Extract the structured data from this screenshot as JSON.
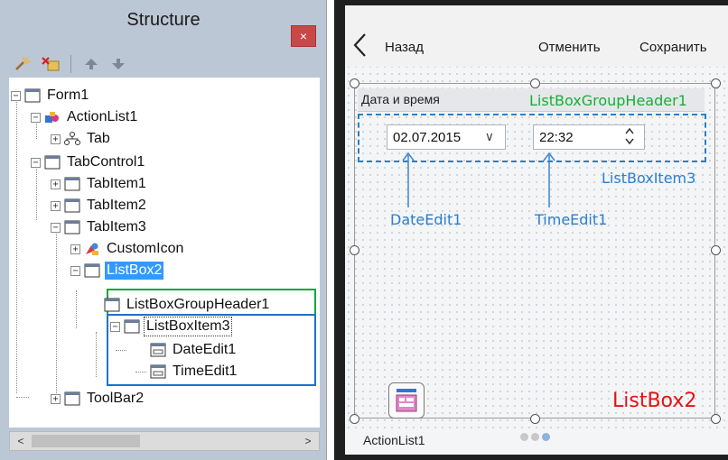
{
  "structure_panel": {
    "title": "Structure",
    "close_label": "×",
    "toolbar": {
      "icons": [
        "new-item-icon",
        "delete-item-icon",
        "move-up-icon",
        "move-down-icon"
      ]
    },
    "tree": [
      {
        "label": "Form1",
        "expander": "−",
        "icon": "form-icon"
      },
      {
        "label": "ActionList1",
        "expander": "−",
        "icon": "actionlist-icon"
      },
      {
        "label": "Tab",
        "expander": "+",
        "icon": "tab-hierarchy-icon"
      },
      {
        "label": "TabControl1",
        "expander": "−",
        "icon": "window-icon"
      },
      {
        "label": "TabItem1",
        "expander": "+",
        "icon": "window-icon"
      },
      {
        "label": "TabItem2",
        "expander": "+",
        "icon": "window-icon"
      },
      {
        "label": "TabItem3",
        "expander": "−",
        "icon": "window-icon"
      },
      {
        "label": "CustomIcon",
        "expander": "+",
        "icon": "customicon-icon"
      },
      {
        "label": "ListBox2",
        "expander": "−",
        "icon": "window-icon",
        "selected": true
      },
      {
        "label": "ListBoxGroupHeader1",
        "expander": "",
        "icon": "window-icon"
      },
      {
        "label": "ListBoxItem3",
        "expander": "−",
        "icon": "window-icon"
      },
      {
        "label": "DateEdit1",
        "expander": "",
        "icon": "edit-icon"
      },
      {
        "label": "TimeEdit1",
        "expander": "",
        "icon": "edit-icon"
      },
      {
        "label": "ToolBar2",
        "expander": "+",
        "icon": "window-icon"
      }
    ],
    "scroll": {
      "left": "<",
      "right": ">"
    }
  },
  "designer": {
    "header": {
      "back_label": "Назад",
      "cancel_label": "Отменить",
      "save_label": "Сохранить"
    },
    "group_header_text": "Дата и время",
    "date_value": "02.07.2015",
    "date_dropdown": "∨",
    "time_value": "22:32",
    "annotations": {
      "group_header": "ListBoxGroupHeader1",
      "list_item": "ListBoxItem3",
      "date_edit": "DateEdit1",
      "time_edit": "TimeEdit1",
      "listbox": "ListBox2"
    },
    "action_list_label": "ActionList1",
    "colors": {
      "green_annotation": "#14b034",
      "blue_annotation": "#2b7fd0",
      "red_annotation": "#e01414",
      "selection": "#3399ff"
    }
  }
}
